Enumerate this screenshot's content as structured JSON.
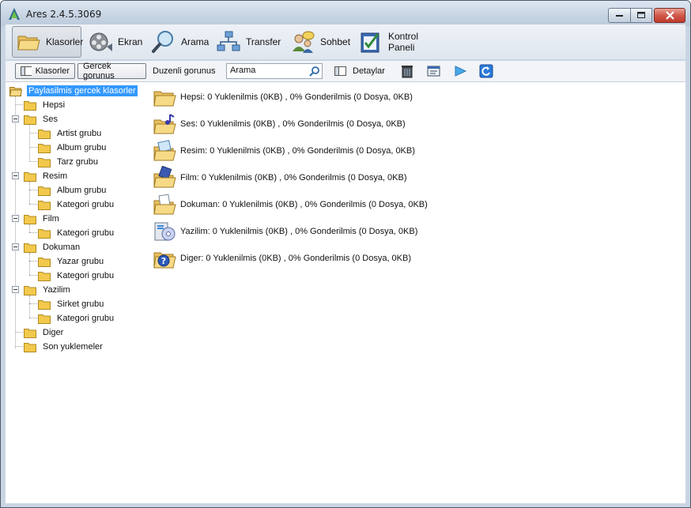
{
  "window": {
    "title": "Ares 2.4.5.3069"
  },
  "main_toolbar": {
    "items": [
      {
        "label": "Klasorler"
      },
      {
        "label": "Ekran"
      },
      {
        "label": "Arama"
      },
      {
        "label": "Transfer"
      },
      {
        "label": "Sohbet"
      },
      {
        "label": "Kontrol Paneli"
      }
    ]
  },
  "sub_toolbar": {
    "folders_label": "Klasorler",
    "real_view_label": "Gercek gorunus",
    "regular_view_label": "Duzenli gorunus",
    "search_value": "Arama",
    "details_label": "Detaylar"
  },
  "tree": {
    "root": "Paylasilmis gercek klasorler",
    "items": [
      {
        "label": "Hepsi"
      },
      {
        "label": "Ses"
      },
      {
        "label": "Artist grubu"
      },
      {
        "label": "Album grubu"
      },
      {
        "label": "Tarz grubu"
      },
      {
        "label": "Resim"
      },
      {
        "label": "Album grubu"
      },
      {
        "label": "Kategori grubu"
      },
      {
        "label": "Film"
      },
      {
        "label": "Kategori grubu"
      },
      {
        "label": "Dokuman"
      },
      {
        "label": "Yazar grubu"
      },
      {
        "label": "Kategori grubu"
      },
      {
        "label": "Yazilim"
      },
      {
        "label": "Sirket grubu"
      },
      {
        "label": "Kategori grubu"
      },
      {
        "label": "Diger"
      },
      {
        "label": "Son yuklemeler"
      }
    ]
  },
  "content": {
    "rows": [
      {
        "text": "Hepsi: 0 Yuklenilmis (0KB) , 0% Gonderilmis (0 Dosya, 0KB)",
        "icon": "folder-all-icon"
      },
      {
        "text": "Ses: 0 Yuklenilmis (0KB) , 0% Gonderilmis (0 Dosya, 0KB)",
        "icon": "folder-audio-icon"
      },
      {
        "text": "Resim: 0 Yuklenilmis (0KB) , 0% Gonderilmis (0 Dosya, 0KB)",
        "icon": "folder-image-icon"
      },
      {
        "text": "Film: 0 Yuklenilmis (0KB) , 0% Gonderilmis (0 Dosya, 0KB)",
        "icon": "folder-video-icon"
      },
      {
        "text": "Dokuman: 0 Yuklenilmis (0KB) , 0% Gonderilmis (0 Dosya, 0KB)",
        "icon": "folder-document-icon"
      },
      {
        "text": "Yazilim: 0 Yuklenilmis (0KB) , 0% Gonderilmis (0 Dosya, 0KB)",
        "icon": "folder-software-icon"
      },
      {
        "text": "Diger: 0 Yuklenilmis (0KB) , 0% Gonderilmis (0 Dosya, 0KB)",
        "icon": "folder-other-icon"
      }
    ]
  },
  "colors": {
    "selection": "#3399ff",
    "folder": "#f2c94c",
    "window_frame": "#c9d5e3"
  }
}
